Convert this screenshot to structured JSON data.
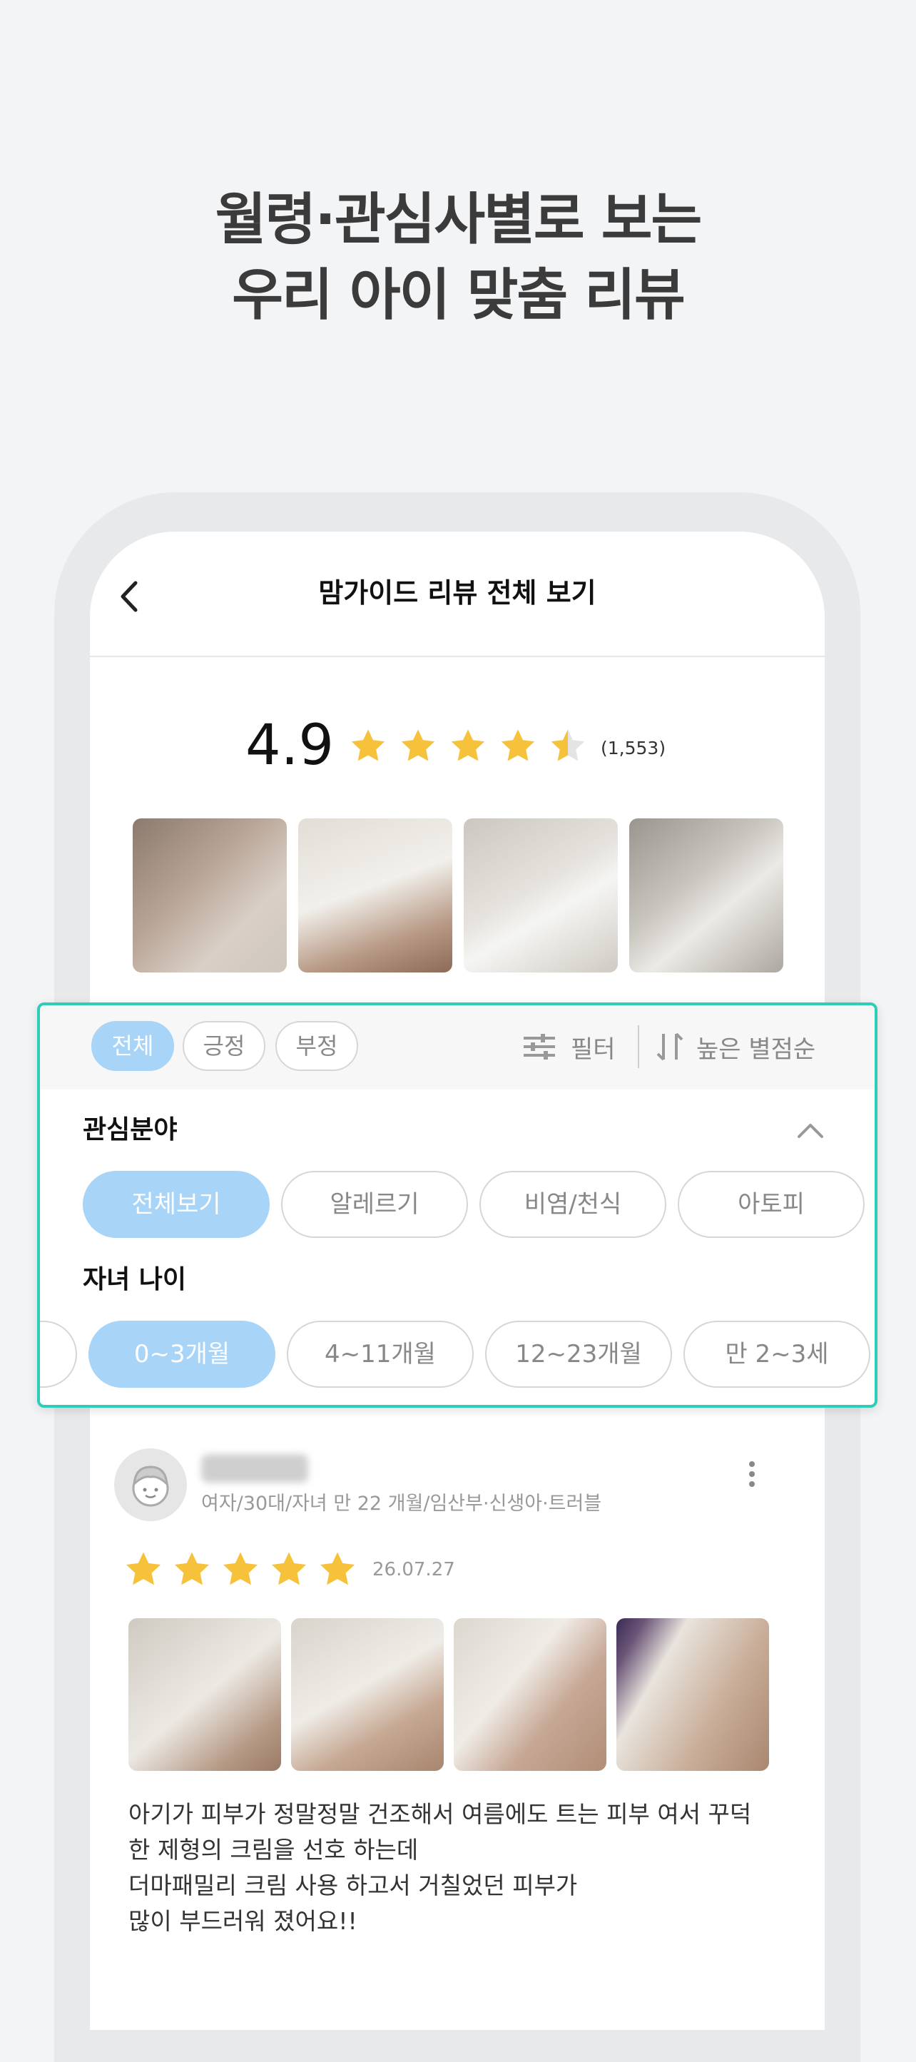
{
  "headline": {
    "line1": "월령·관심사별로 보는",
    "line2": "우리 아이 맞춤 리뷰"
  },
  "nav": {
    "title": "맘가이드 리뷰 전체 보기",
    "back_icon": "chevron-left-icon"
  },
  "rating": {
    "score": "4.9",
    "stars": 4.5,
    "count": "(1,553)",
    "star_color": "#f7c23b"
  },
  "tabs": {
    "items": [
      "전체",
      "긍정",
      "부정"
    ],
    "active": 0,
    "filter_label": "필터",
    "sort_label": "높은 별점순"
  },
  "interest": {
    "title": "관심분야",
    "options": [
      "전체보기",
      "알레르기",
      "비염/천식",
      "아토피"
    ],
    "active": 0
  },
  "age": {
    "title": "자녀 나이",
    "options": [
      "0~3개월",
      "4~11개월",
      "12~23개월",
      "만 2~3세"
    ],
    "active": 0
  },
  "review": {
    "meta": "여자/30대/자녀 만 22 개월/임산부·신생아·트러블",
    "stars": 5,
    "date": "26.07.27",
    "text": [
      "아기가 피부가 정말정말 건조해서 여름에도 트는 피부 여서 꾸덕",
      "한 제형의 크림을 선호 하는데",
      "더마패밀리 크림 사용 하고서 거칠었던 피부가",
      "많이 부드러워 졌어요!!"
    ]
  },
  "colors": {
    "accent_chip": "#a8d4f7",
    "highlight_border": "#2ecdb8"
  }
}
